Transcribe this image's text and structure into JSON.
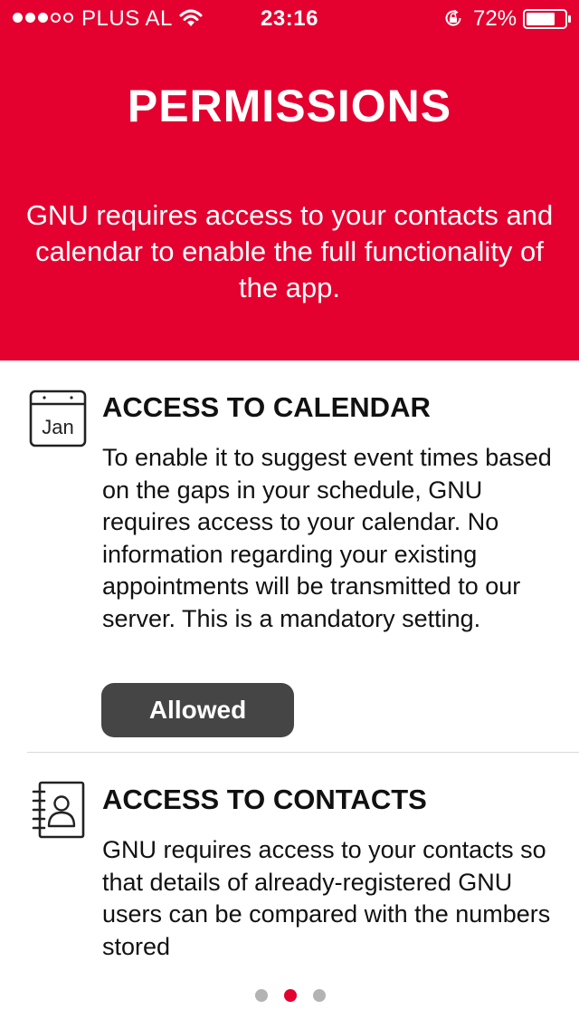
{
  "status_bar": {
    "carrier": "PLUS AL",
    "time": "23:16",
    "battery": "72%",
    "signal_strength": 3,
    "signal_max": 5,
    "battery_level": 0.72
  },
  "header": {
    "title": "PERMISSIONS",
    "intro": "GNU requires access to your contacts and calendar to enable the full functionality of the app.",
    "background_color": "#e4002f"
  },
  "calendar_section": {
    "icon": "calendar-icon",
    "icon_label": "Jan",
    "title": "ACCESS TO CALENDAR",
    "body": "To enable it to suggest event times based on the gaps in your schedule, GNU requires access to your calendar. No information regarding your existing appointments will be transmitted to our server. This is a mandatory setting.",
    "button_label": "Allowed"
  },
  "contacts_section": {
    "icon": "contacts-book-icon",
    "title": "ACCESS TO CONTACTS",
    "body": "GNU requires access to your contacts so that details of already-registered GNU users can be compared with the numbers stored"
  },
  "pager": {
    "pages": 3,
    "active_index": 1,
    "active_color": "#e4002f"
  }
}
